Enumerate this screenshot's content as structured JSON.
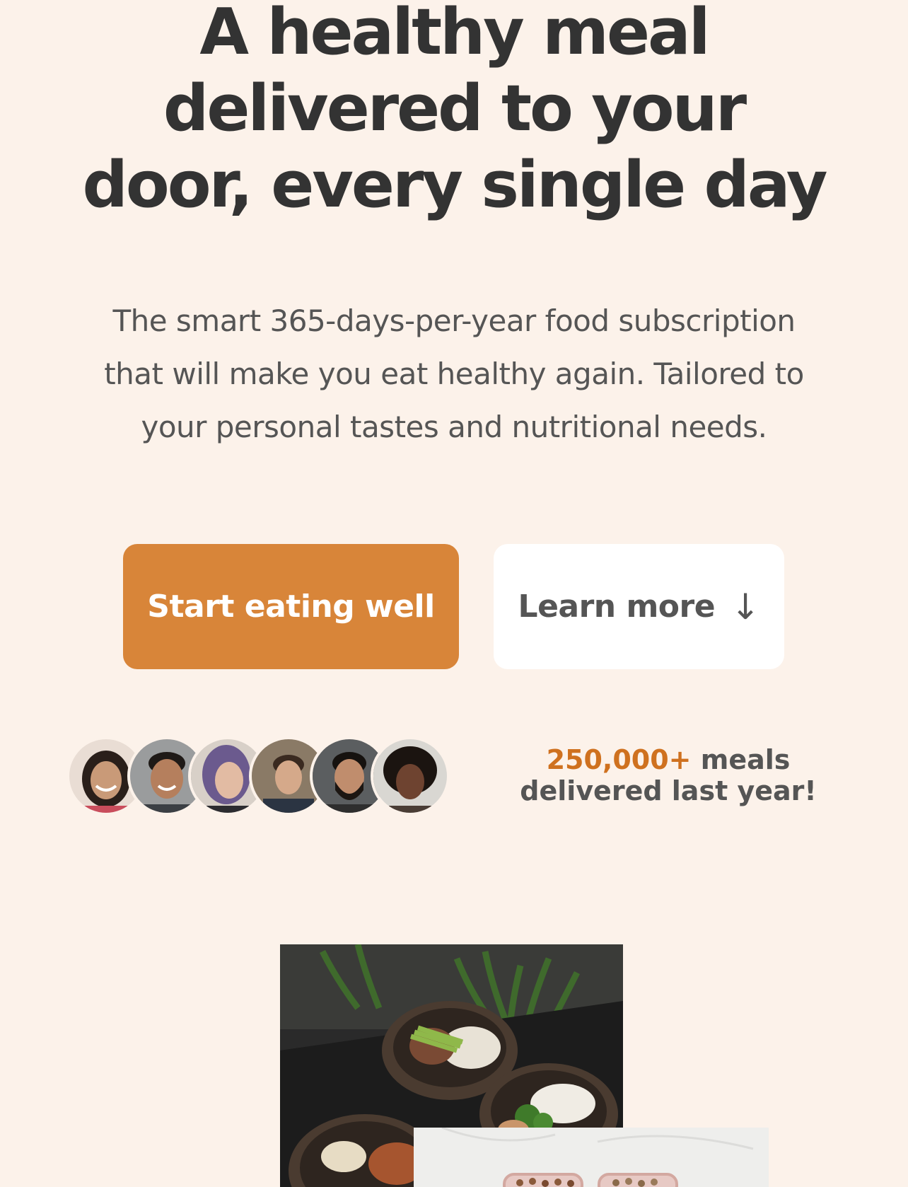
{
  "hero": {
    "title_lines": [
      "A healthy meal",
      "delivered to your",
      "door, every single day"
    ],
    "description_lines": [
      "The smart 365-days-per-year food subscription",
      "that will make you eat healthy again. Tailored to",
      "your personal tastes and nutritional needs."
    ]
  },
  "cta": {
    "primary_label": "Start eating well",
    "secondary_label": "Learn more",
    "secondary_arrow": "↓"
  },
  "stats": {
    "count": "250,000+",
    "text_part1": "meals",
    "text_part2": "delivered last year!"
  },
  "colors": {
    "background": "#fcf2ea",
    "primary": "#d88539",
    "accent_text": "#cf711f",
    "heading": "#333333",
    "body_text": "#555555"
  }
}
